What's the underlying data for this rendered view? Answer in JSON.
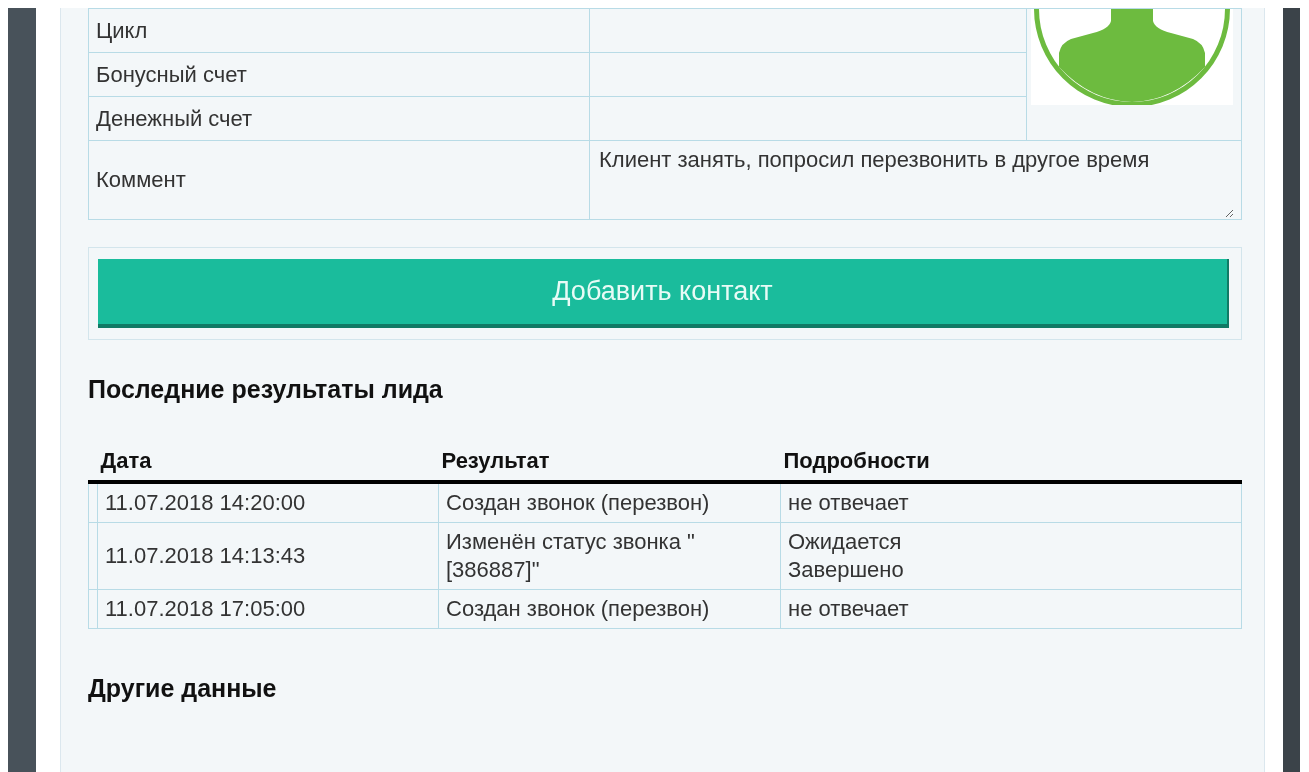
{
  "form": {
    "rows": [
      {
        "label": "Цикл",
        "value": ""
      },
      {
        "label": "Бонусный счет",
        "value": ""
      },
      {
        "label": "Денежный счет",
        "value": ""
      }
    ],
    "comment": {
      "label": "Коммент",
      "value": "Клиент занять, попросил перезвонить в другое время"
    }
  },
  "add_button": "Добавить контакт",
  "results": {
    "title": "Последние результаты лида",
    "columns": [
      "Дата",
      "Результат",
      "Подробности"
    ],
    "rows": [
      {
        "date": "11.07.2018 14:20:00",
        "result": "Создан звонок (перезвон)",
        "details": [
          "не отвечает"
        ]
      },
      {
        "date": "11.07.2018 14:13:43",
        "result": "Изменён статус звонка \" [386887]\"",
        "details": [
          "Ожидается",
          "Завершено"
        ]
      },
      {
        "date": "11.07.2018 17:05:00",
        "result": "Создан звонок (перезвон)",
        "details": [
          "не отвечает"
        ]
      }
    ]
  },
  "other_title": "Другие данные"
}
